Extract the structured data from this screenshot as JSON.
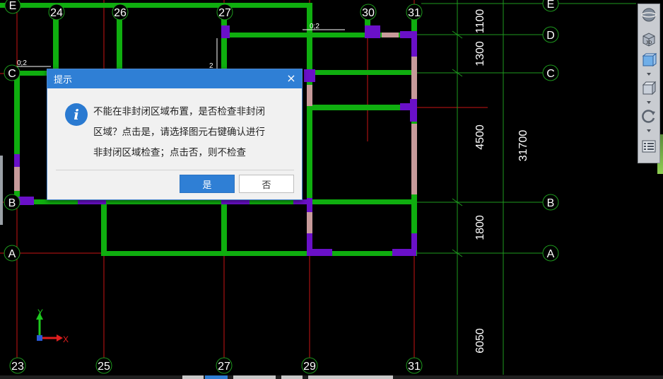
{
  "drawing": {
    "grid_labels_top": [
      "E",
      "24",
      "26",
      "27",
      "30",
      "31",
      "E"
    ],
    "grid_labels_rows": [
      "D",
      "C",
      "B",
      "A"
    ],
    "grid_labels_bottom": [
      "23",
      "25",
      "27",
      "29",
      "31"
    ],
    "dimensions": [
      "1100",
      "1300",
      "4500",
      "1800",
      "6050",
      "31700"
    ],
    "annotations": [
      "0;2",
      "0;2",
      "2"
    ],
    "ucs": {
      "y": "Y",
      "x": "X"
    }
  },
  "dialog": {
    "title": "提示",
    "close": "×",
    "icon": "i",
    "message_lines": [
      "不能在非封闭区域布置，是否检查非封闭",
      "区域？点击是，请选择图元右键确认进行",
      "非封闭区域检查；点击否，则不检查"
    ],
    "yes_label": "是",
    "no_label": "否"
  },
  "view_toolbar": {
    "buttons": [
      "globe-icon",
      "3d-view-icon",
      "top-view-icon",
      "box-view-icon",
      "rotate-icon",
      "layer-panel-icon"
    ],
    "labels": {
      "3d": "3D"
    }
  },
  "colors": {
    "background": "#000000",
    "wall_green": "#0fae0f",
    "column_purple": "#6a10c8",
    "grid_red": "#c81414",
    "dim_green": "#1e9a1e",
    "dialog_accent": "#2f7fd5"
  }
}
